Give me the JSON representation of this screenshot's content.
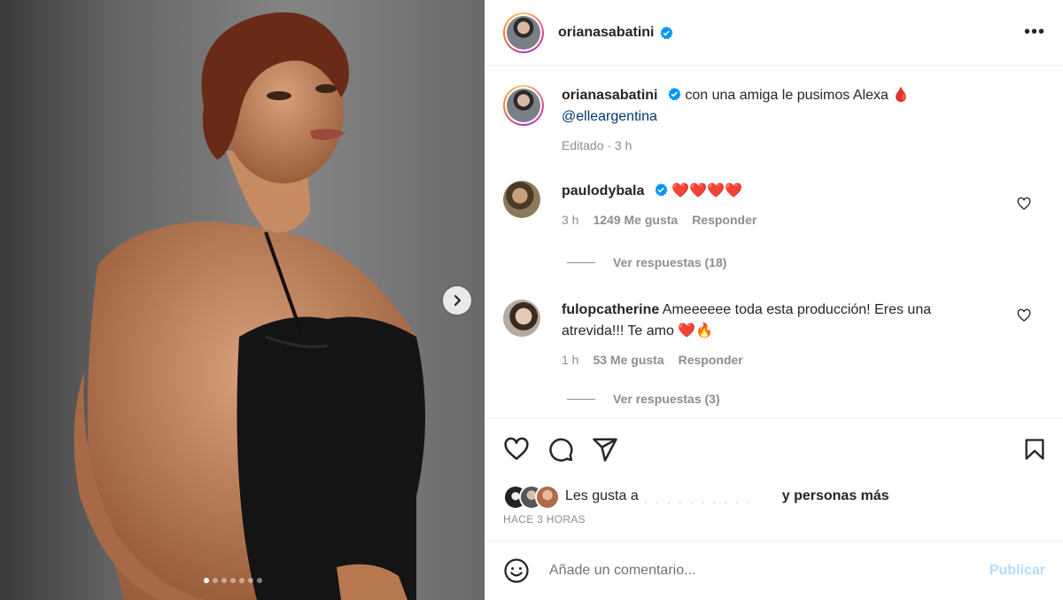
{
  "post": {
    "author": {
      "username": "orianasabatini",
      "verified": true,
      "avatar_icon": "avatar-image"
    },
    "more_icon": "more-horizontal-icon",
    "carousel": {
      "dots_total": 7,
      "active_index": 0,
      "next_icon": "chevron-right-icon"
    },
    "caption": {
      "username": "orianasabatini",
      "text": "con una amiga le pusimos Alexa 🩸",
      "mention": "@elleargentina",
      "edited_label": "Editado · 3 h"
    },
    "comments": [
      {
        "username": "paulodybala",
        "verified": true,
        "text": "❤️❤️❤️❤️",
        "time": "3 h",
        "likes": "1249 Me gusta",
        "reply_label": "Responder",
        "view_replies": "Ver respuestas (18)"
      },
      {
        "username": "fulopcatherine",
        "verified": false,
        "text": "Ameeeeee toda esta producción! Eres una atrevida!!! Te amo ❤️🔥",
        "time": "1 h",
        "likes": "53 Me gusta",
        "reply_label": "Responder",
        "view_replies": "Ver respuestas (3)"
      }
    ],
    "actions": {
      "icons": [
        "heart-icon",
        "comment-icon",
        "share-icon",
        "bookmark-icon"
      ]
    },
    "likes": {
      "prefix": "Les gusta a",
      "suffix": "y personas más"
    },
    "timestamp": "HACE 3 HORAS",
    "composer": {
      "emoji_icon": "emoji-icon",
      "placeholder": "Añade un comentario...",
      "publish_label": "Publicar"
    }
  },
  "colors": {
    "verified_blue": "#0095f6",
    "link_blue": "#00376b",
    "publish_disabled": "#b3dbff",
    "heart_red": "#ed4956"
  }
}
